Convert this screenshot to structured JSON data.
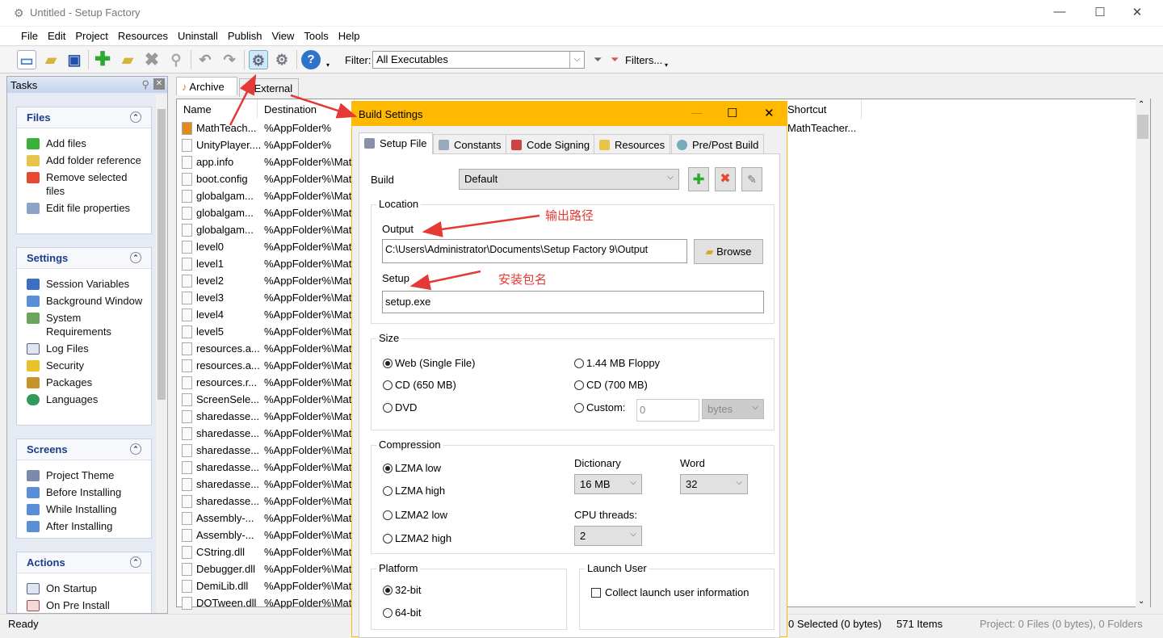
{
  "window": {
    "title": "Untitled - Setup Factory",
    "minimize": "—",
    "maximize": "☐",
    "close": "✕"
  },
  "menu": [
    "File",
    "Edit",
    "Project",
    "Resources",
    "Uninstall",
    "Publish",
    "View",
    "Tools",
    "Help"
  ],
  "toolbar": {
    "filter_label": "Filter:",
    "filter_value": "All Executables",
    "filters_label": "Filters...",
    "icons": [
      "new-project",
      "open",
      "save",
      "add-files",
      "add-folder",
      "remove",
      "find",
      "undo",
      "redo",
      "build-settings",
      "build",
      "help"
    ]
  },
  "tasks": {
    "title": "Tasks",
    "sections": [
      {
        "title": "Files",
        "items": [
          "Add files",
          "Add folder reference",
          "Remove selected files",
          "Edit file properties"
        ]
      },
      {
        "title": "Settings",
        "items": [
          "Session Variables",
          "Background Window",
          "System Requirements",
          "Log Files",
          "Security",
          "Packages",
          "Languages"
        ]
      },
      {
        "title": "Screens",
        "items": [
          "Project Theme",
          "Before Installing",
          "While Installing",
          "After Installing"
        ]
      },
      {
        "title": "Actions",
        "items": [
          "On Startup",
          "On Pre Install"
        ]
      }
    ]
  },
  "main_tabs": [
    "Archive",
    "External"
  ],
  "filelist": {
    "columns": [
      "Name",
      "Destination",
      "Shortcut"
    ],
    "rows": [
      [
        "MathTeach...",
        "%AppFolder%",
        "MathTeacher..."
      ],
      [
        "UnityPlayer....",
        "%AppFolder%",
        ""
      ],
      [
        "app.info",
        "%AppFolder%\\Mat",
        ""
      ],
      [
        "boot.config",
        "%AppFolder%\\Mat",
        ""
      ],
      [
        "globalgam...",
        "%AppFolder%\\Mat",
        ""
      ],
      [
        "globalgam...",
        "%AppFolder%\\Mat",
        ""
      ],
      [
        "globalgam...",
        "%AppFolder%\\Mat",
        ""
      ],
      [
        "level0",
        "%AppFolder%\\Mat",
        ""
      ],
      [
        "level1",
        "%AppFolder%\\Mat",
        ""
      ],
      [
        "level2",
        "%AppFolder%\\Mat",
        ""
      ],
      [
        "level3",
        "%AppFolder%\\Mat",
        ""
      ],
      [
        "level4",
        "%AppFolder%\\Mat",
        ""
      ],
      [
        "level5",
        "%AppFolder%\\Mat",
        ""
      ],
      [
        "resources.a...",
        "%AppFolder%\\Mat",
        ""
      ],
      [
        "resources.a...",
        "%AppFolder%\\Mat",
        ""
      ],
      [
        "resources.r...",
        "%AppFolder%\\Mat",
        ""
      ],
      [
        "ScreenSele...",
        "%AppFolder%\\Mat",
        ""
      ],
      [
        "sharedasse...",
        "%AppFolder%\\Mat",
        ""
      ],
      [
        "sharedasse...",
        "%AppFolder%\\Mat",
        ""
      ],
      [
        "sharedasse...",
        "%AppFolder%\\Mat",
        ""
      ],
      [
        "sharedasse...",
        "%AppFolder%\\Mat",
        ""
      ],
      [
        "sharedasse...",
        "%AppFolder%\\Mat",
        ""
      ],
      [
        "sharedasse...",
        "%AppFolder%\\Mat",
        ""
      ],
      [
        "Assembly-...",
        "%AppFolder%\\Mat",
        ""
      ],
      [
        "Assembly-...",
        "%AppFolder%\\Mat",
        ""
      ],
      [
        "CString.dll",
        "%AppFolder%\\Mat",
        ""
      ],
      [
        "Debugger.dll",
        "%AppFolder%\\Mat",
        ""
      ],
      [
        "DemiLib.dll",
        "%AppFolder%\\Mat",
        ""
      ],
      [
        "DOTween.dll",
        "%AppFolder%\\Mat",
        ""
      ]
    ]
  },
  "status": {
    "ready": "Ready",
    "selected": "0 Selected (0 bytes)",
    "items": "571 Items",
    "project": "Project: 0 Files (0 bytes), 0 Folders"
  },
  "dialog": {
    "title": "Build Settings",
    "tabs": [
      "Setup File",
      "Constants",
      "Code Signing",
      "Resources",
      "Pre/Post Build"
    ],
    "build_label": "Build",
    "build_value": "Default",
    "location": {
      "title": "Location",
      "output_label": "Output",
      "output_value": "C:\\Users\\Administrator\\Documents\\Setup Factory 9\\Output",
      "browse": "Browse",
      "setup_label": "Setup",
      "setup_value": "setup.exe"
    },
    "size": {
      "title": "Size",
      "options": [
        "Web (Single File)",
        "1.44 MB Floppy",
        "CD (650 MB)",
        "CD (700 MB)",
        "DVD",
        "Custom:"
      ],
      "selected": "Web (Single File)",
      "custom_value": "0",
      "custom_unit": "bytes"
    },
    "compression": {
      "title": "Compression",
      "options": [
        "LZMA low",
        "LZMA high",
        "LZMA2 low",
        "LZMA2 high"
      ],
      "selected": "LZMA low",
      "dictionary_label": "Dictionary",
      "dictionary_value": "16 MB",
      "word_label": "Word",
      "word_value": "32",
      "cpu_label": "CPU threads:",
      "cpu_value": "2"
    },
    "platform": {
      "title": "Platform",
      "options": [
        "32-bit",
        "64-bit"
      ],
      "selected": "32-bit"
    },
    "launch_user": {
      "title": "Launch User",
      "checkbox": "Collect launch user information",
      "checked": false
    }
  },
  "annotations": {
    "output": "输出路径",
    "setup": "安装包名"
  },
  "colors": {
    "dialog_accent": "#FFB900",
    "annotation": "#E53935",
    "task_header": "#1A3C8C"
  }
}
